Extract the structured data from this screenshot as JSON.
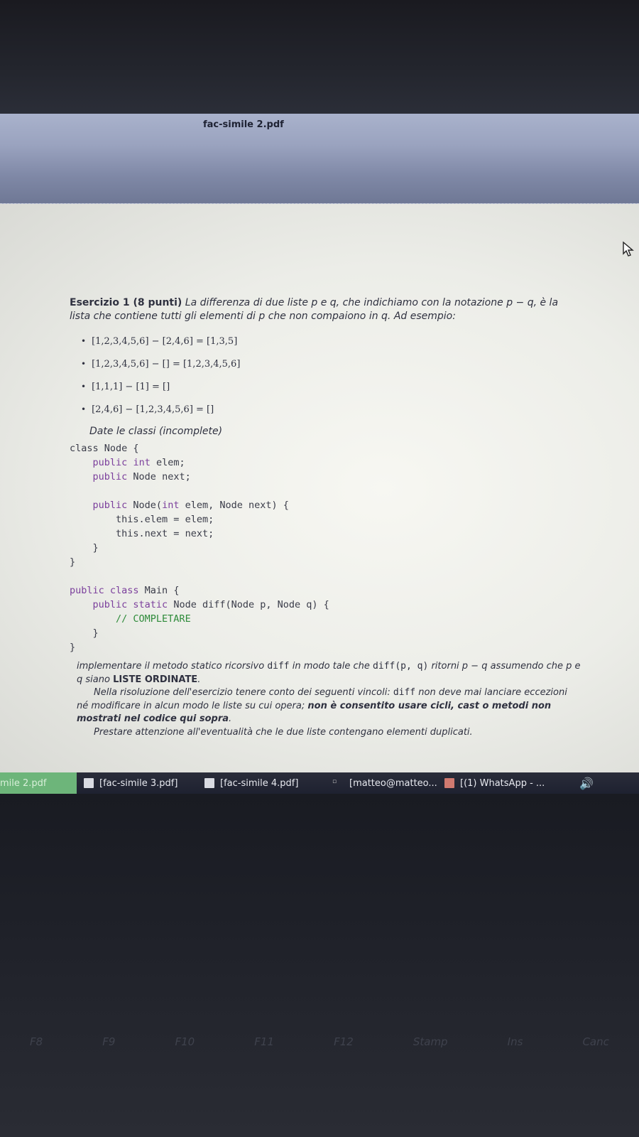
{
  "window": {
    "title": "fac-simile 2.pdf"
  },
  "exercise": {
    "heading": "Esercizio 1 (8 punti)",
    "intro": "La differenza di due liste p e q, che indichiamo con la notazione p − q, è la lista che contiene tutti gli elementi di p che non compaiono in q. Ad esempio:",
    "examples": [
      "[1,2,3,4,5,6] − [2,4,6] = [1,3,5]",
      "[1,2,3,4,5,6] − [] = [1,2,3,4,5,6]",
      "[1,1,1] − [1] = []",
      "[2,4,6] − [1,2,3,4,5,6] = []"
    ],
    "given": "Date le classi (incomplete)",
    "code": {
      "line1": "class Node {",
      "line2a": "public",
      "line2b": "int",
      "line2c": " elem;",
      "line3a": "public",
      "line3b": " Node next;",
      "line5a": "public",
      "line5b": " Node(",
      "line5c": "int",
      "line5d": " elem, Node next) {",
      "line6": "this.elem = elem;",
      "line7": "this.next = next;",
      "line8": "}",
      "line9": "}",
      "line11a": "public class",
      "line11b": " Main {",
      "line12a": "public static",
      "line12b": " Node diff(Node p, Node q) {",
      "line13": "// COMPLETARE",
      "line14": "}",
      "line15": "}"
    },
    "tail": {
      "p1a": "implementare il metodo statico ricorsivo ",
      "p1b": "diff",
      "p1c": " in modo tale che ",
      "p1d": "diff(p, q)",
      "p1e": " ritorni p − q assumendo che p e q siano ",
      "p1f": "LISTE ORDINATE",
      "p1g": ".",
      "p2a": "Nella risoluzione dell'esercizio tenere conto dei seguenti vincoli: ",
      "p2b": "diff",
      "p2c": " non deve mai lanciare eccezioni né modificare in alcun modo le liste su cui opera; ",
      "p2d": "non è consentito usare cicli, cast o metodi non mostrati nel codice qui sopra",
      "p2e": ".",
      "p3": "Prestare attenzione all'eventualità che le due liste contengano elementi duplicati."
    }
  },
  "taskbar": {
    "items": [
      {
        "label": "mile 2.pdf",
        "icon": "document-icon",
        "active": true
      },
      {
        "label": "[fac-simile 3.pdf]",
        "icon": "document-icon",
        "active": false
      },
      {
        "label": "[fac-simile 4.pdf]",
        "icon": "document-icon",
        "active": false
      },
      {
        "label": "[matteo@matteo...",
        "icon": "terminal-icon",
        "active": false
      },
      {
        "label": "[(1) WhatsApp - ...",
        "icon": "whatsapp-icon",
        "active": false
      }
    ],
    "volume_icon": "speaker-icon"
  },
  "keyboard": {
    "keys": [
      "F8",
      "F9",
      "F10",
      "F11",
      "F12",
      "Stamp",
      "Ins",
      "Canc"
    ]
  }
}
